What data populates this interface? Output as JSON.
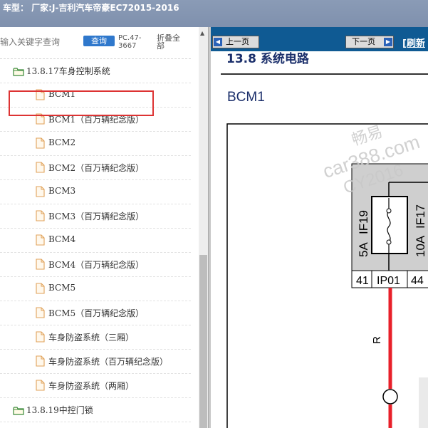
{
  "window": {
    "title": "车型： 厂家:J-吉利汽车帝豪EC72015-2016"
  },
  "search": {
    "placeholder": "输入关键字查询",
    "query_button": "查询",
    "pc_code": "PC.47-3667",
    "collapse_all": "折叠全部"
  },
  "tree": {
    "items": [
      {
        "type": "folder",
        "label": "13.8.17车身控制系统",
        "highlighted": true
      },
      {
        "type": "file",
        "label": "BCM1"
      },
      {
        "type": "file",
        "label": "BCM1（百万辆纪念版）"
      },
      {
        "type": "file",
        "label": "BCM2"
      },
      {
        "type": "file",
        "label": "BCM2（百万辆纪念版）"
      },
      {
        "type": "file",
        "label": "BCM3"
      },
      {
        "type": "file",
        "label": "BCM3（百万辆纪念版）"
      },
      {
        "type": "file",
        "label": "BCM4"
      },
      {
        "type": "file",
        "label": "BCM4（百万辆纪念版）"
      },
      {
        "type": "file",
        "label": "BCM5"
      },
      {
        "type": "file",
        "label": "BCM5（百万辆纪念版）"
      },
      {
        "type": "file",
        "label": "车身防盗系统（三厢）"
      },
      {
        "type": "file",
        "label": "车身防盗系统（百万辆纪念版）"
      },
      {
        "type": "file",
        "label": "车身防盗系统（两厢）"
      },
      {
        "type": "folder",
        "label": "13.8.19中控门锁"
      }
    ]
  },
  "viewer": {
    "prev_page": "上一页",
    "next_page": "下一页",
    "refresh": "[刷新",
    "section_heading": "13.8 系统电路",
    "page_title": "BCM1"
  },
  "diagram": {
    "fuses": [
      {
        "id": "IF19",
        "rating": "5A"
      },
      {
        "id": "IF17",
        "rating": "10A"
      }
    ],
    "connector": {
      "id": "IP01",
      "pin_left": "41",
      "pin_right": "44"
    },
    "wire_color_label": "R",
    "watermarks": [
      "畅易",
      "car388.com",
      "CY2016"
    ]
  },
  "colors": {
    "title_bar": "#8496b2",
    "viewer_bar": "#0f5a93",
    "highlight_box": "#dd3333",
    "wire": "#e8202a",
    "query_button": "#2f78cc"
  }
}
